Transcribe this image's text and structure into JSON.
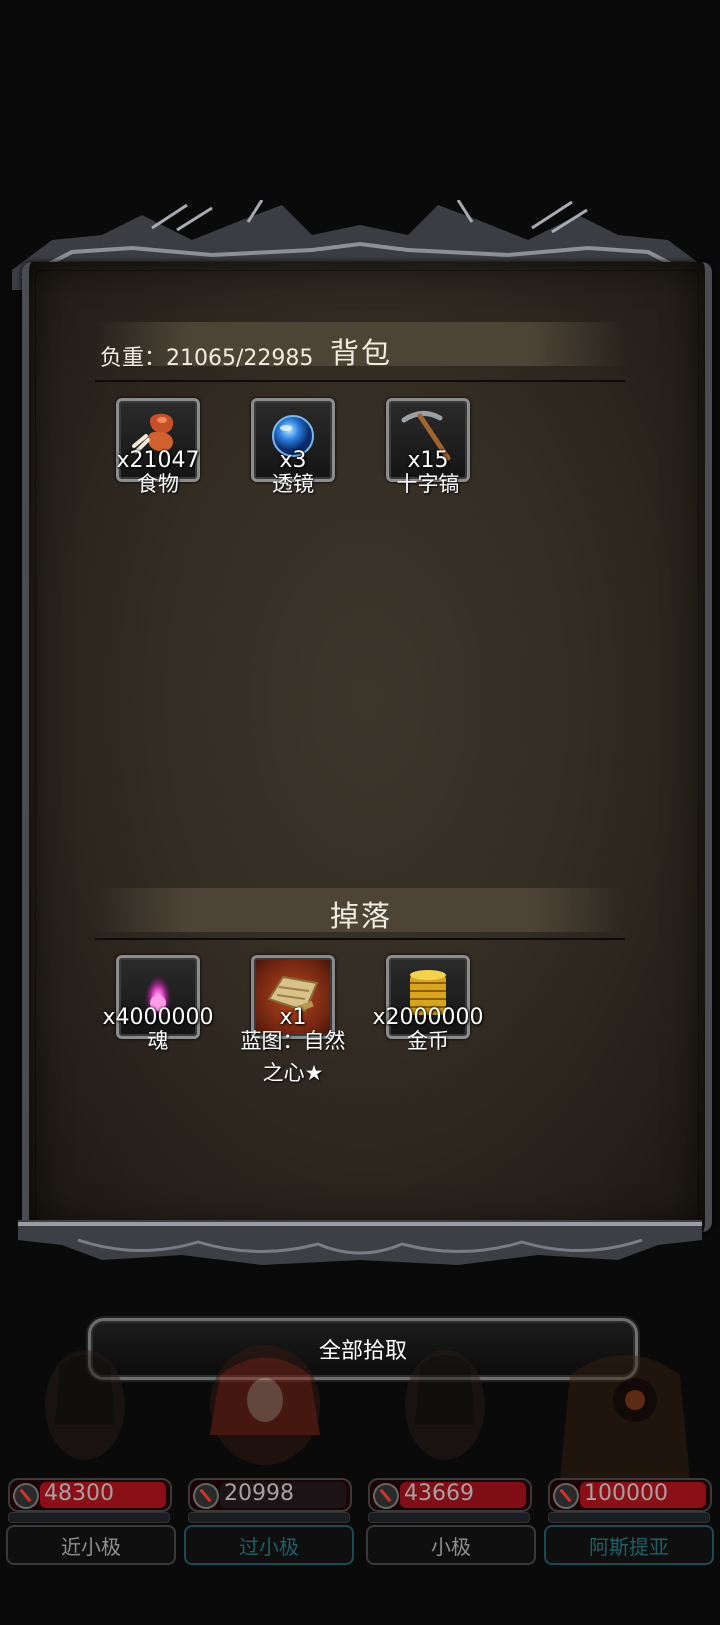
{
  "backpack": {
    "weight_label": "负重：21065/22985",
    "title": "背包",
    "items": [
      {
        "name": "食物",
        "qty": "x21047",
        "icon": "food-icon"
      },
      {
        "name": "透镜",
        "qty": "x3",
        "icon": "lens-icon"
      },
      {
        "name": "十字镐",
        "qty": "x15",
        "icon": "pickaxe-icon"
      }
    ]
  },
  "drops": {
    "title": "掉落",
    "items": [
      {
        "name": "魂",
        "qty": "x4000000",
        "icon": "soul-icon"
      },
      {
        "name_line1": "蓝图：自然",
        "name_line2": "之心★",
        "qty": "x1",
        "icon": "blueprint-scroll-icon"
      },
      {
        "name": "金币",
        "qty": "x2000000",
        "icon": "gold-coins-icon"
      }
    ]
  },
  "pickup_button": "全部拾取",
  "party": [
    {
      "name": "近小极",
      "hp": "48300",
      "hp_color": "#8a0f17",
      "name_style": "gray"
    },
    {
      "name": "过小极",
      "hp": "20998",
      "hp_color": "#1b1416",
      "name_style": "teal"
    },
    {
      "name": "小极",
      "hp": "43669",
      "hp_color": "#7f0e16",
      "name_style": "gray"
    },
    {
      "name": "阿斯提亚",
      "hp": "100000",
      "hp_color": "#8a0f17",
      "name_style": "teal"
    }
  ]
}
